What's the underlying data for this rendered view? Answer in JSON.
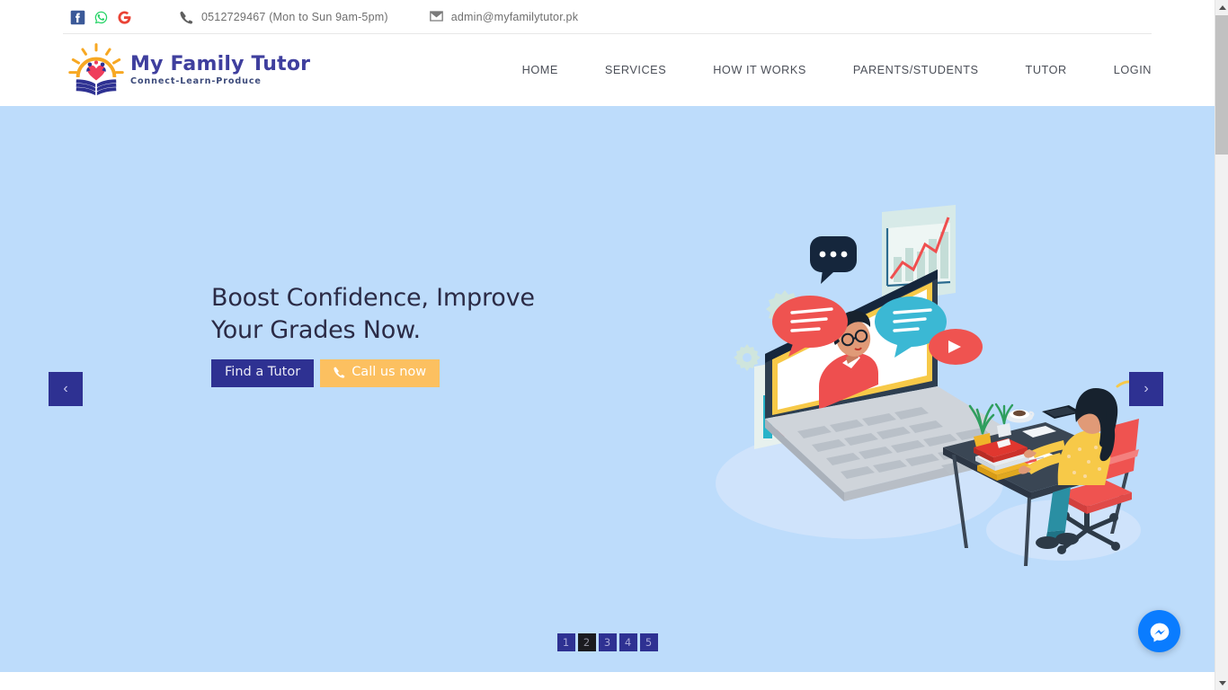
{
  "topbar": {
    "social": [
      {
        "name": "facebook-icon",
        "label": "Facebook",
        "color": "#3b5998"
      },
      {
        "name": "whatsapp-icon",
        "label": "WhatsApp",
        "color": "#25d366"
      },
      {
        "name": "google-icon",
        "label": "Google",
        "color": "#ea4335"
      }
    ],
    "phone_icon": "phone-icon",
    "phone": "0512729467 (Mon to Sun 9am-5pm)",
    "email_icon": "envelope-icon",
    "email": "admin@myfamilytutor.pk"
  },
  "header": {
    "logo": {
      "title": "My Family Tutor",
      "tagline": "Connect-Learn-Produce",
      "mark": "sun-heart-book-logo-icon",
      "colors": {
        "sun": "#f7a823",
        "heart": "#ef3d5c",
        "book": "#2e3192",
        "title": "#3f3f9e"
      }
    },
    "nav": [
      {
        "label": "HOME",
        "name": "nav-home"
      },
      {
        "label": "SERVICES",
        "name": "nav-services"
      },
      {
        "label": "HOW IT WORKS",
        "name": "nav-how-it-works"
      },
      {
        "label": "PARENTS/STUDENTS",
        "name": "nav-parents-students"
      },
      {
        "label": "TUTOR",
        "name": "nav-tutor"
      },
      {
        "label": "LOGIN",
        "name": "nav-login"
      }
    ]
  },
  "hero": {
    "background_color": "#bddcfb",
    "title": "Boost Confidence, Improve Your Grades Now.",
    "buttons": {
      "find_tutor": {
        "label": "Find a Tutor",
        "color": "#2e3192"
      },
      "call_now": {
        "label": "Call us now",
        "icon": "phone-icon",
        "color": "#fcc060"
      }
    },
    "prev_arrow": "‹",
    "next_arrow": "›",
    "pagination": {
      "items": [
        "1",
        "2",
        "3",
        "4",
        "5"
      ],
      "active_index": 1,
      "active_color": "#1b1b1f",
      "inactive_color": "#2e3192"
    },
    "illustration": {
      "name": "online-tutoring-isometric-illustration",
      "description": "Isometric laptop showing a tutor on screen with chat bubbles, gears and charts; a student sits at a desk with books, plant and coffee."
    }
  },
  "chat_widget": {
    "name": "messenger-chat-button",
    "icon": "messenger-icon",
    "color": "#0a7cff"
  },
  "scrollbar": {
    "up_arrow": "▲",
    "down_arrow": "▼"
  }
}
